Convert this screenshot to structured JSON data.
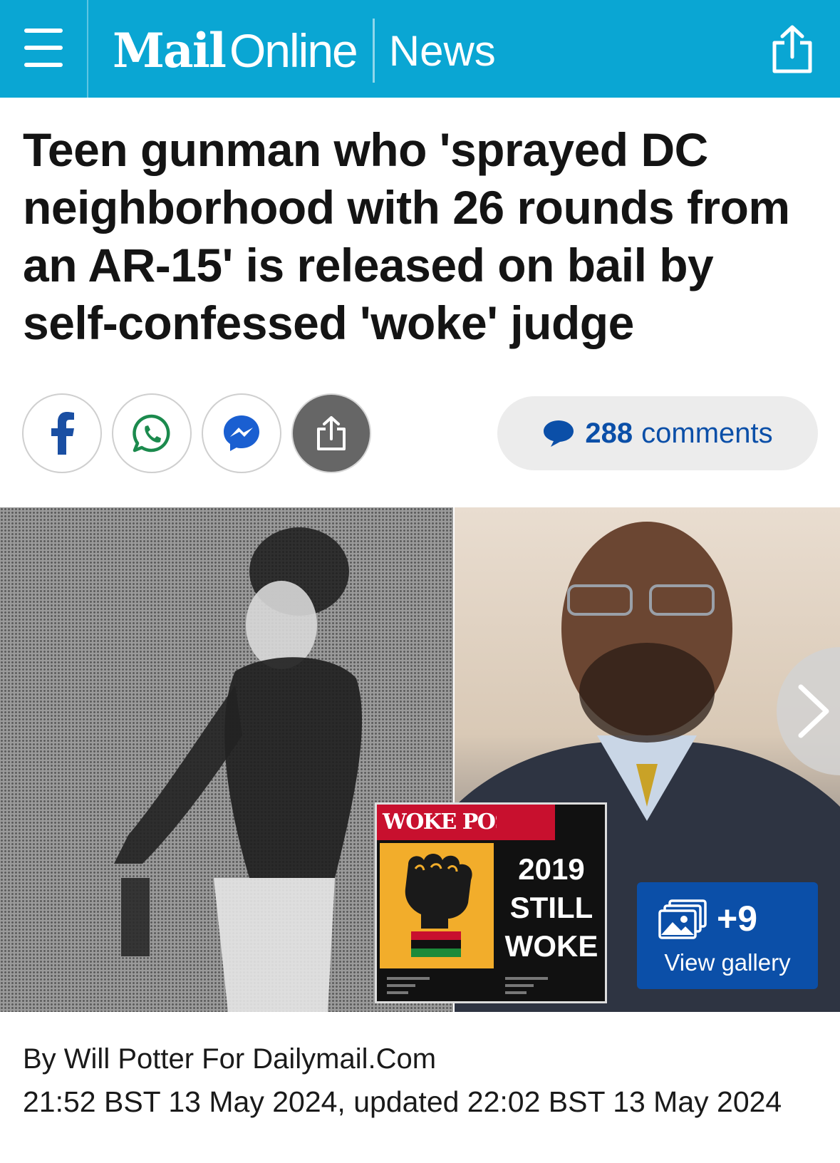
{
  "header": {
    "logo_mail": "Mail",
    "logo_online": "Online",
    "section": "News",
    "background_color": "#0aa6d3",
    "menu_icon": "hamburger-menu-icon",
    "share_icon": "share-icon"
  },
  "article": {
    "headline": "Teen gunman who 'sprayed DC neighborhood with 26 rounds from an AR-15' is released on bail by self-confessed 'woke' judge",
    "byline": "By Will Potter For Dailymail.Com",
    "dateline": "21:52 BST 13 May 2024, updated 22:02 BST 13 May 2024"
  },
  "share_buttons": [
    {
      "name": "facebook",
      "icon": "facebook-icon"
    },
    {
      "name": "whatsapp",
      "icon": "whatsapp-icon"
    },
    {
      "name": "messenger",
      "icon": "messenger-icon"
    },
    {
      "name": "more-share",
      "icon": "share-icon"
    }
  ],
  "comments": {
    "count": "288",
    "label": "comments",
    "icon": "comment-bubble-icon",
    "color": "#0b4fa8"
  },
  "hero": {
    "inset": {
      "title": "WOKE POSTS",
      "line1": "2019",
      "line2": "STILL",
      "line3": "WOKE"
    },
    "gallery": {
      "count": "+9",
      "label": "View gallery",
      "icon": "gallery-icon",
      "color": "#0b4fa8"
    },
    "next_icon": "chevron-right-icon"
  }
}
